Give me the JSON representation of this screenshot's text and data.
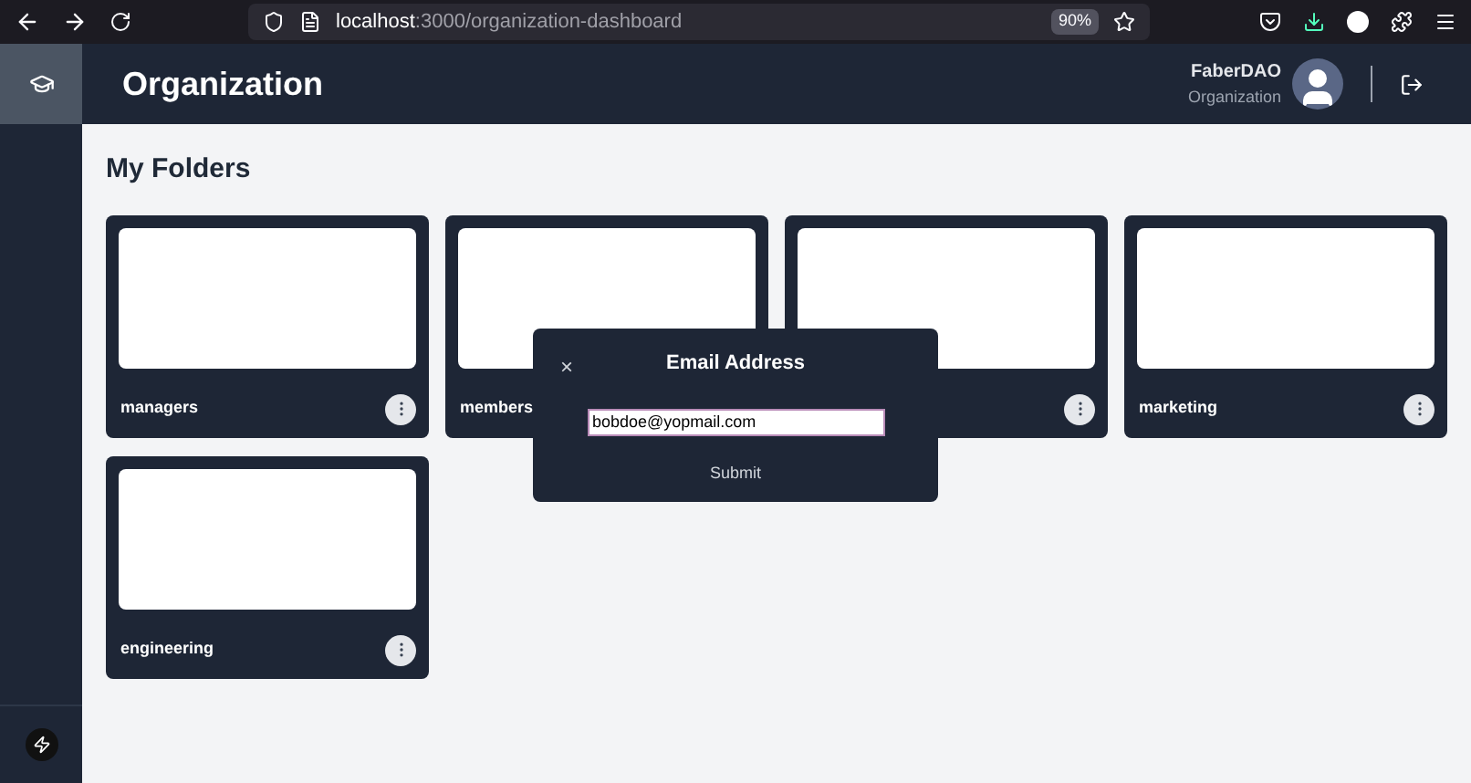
{
  "browser": {
    "url_host": "localhost",
    "url_path": ":3000/organization-dashboard",
    "zoom": "90%"
  },
  "header": {
    "title": "Organization",
    "user_name": "FaberDAO",
    "user_role": "Organization"
  },
  "section_title": "My Folders",
  "folders": [
    {
      "kind": "folder",
      "name": "managers"
    },
    {
      "kind": "name_only",
      "name": "members"
    },
    {
      "kind": "folder"
    },
    {
      "kind": "folder",
      "name": "marketing"
    },
    {
      "kind": "folder",
      "name": "engineering"
    }
  ],
  "dialog": {
    "title": "Email Address",
    "close": "×",
    "email_value": "bobdoe@yopmail.com",
    "submit": "Submit"
  }
}
